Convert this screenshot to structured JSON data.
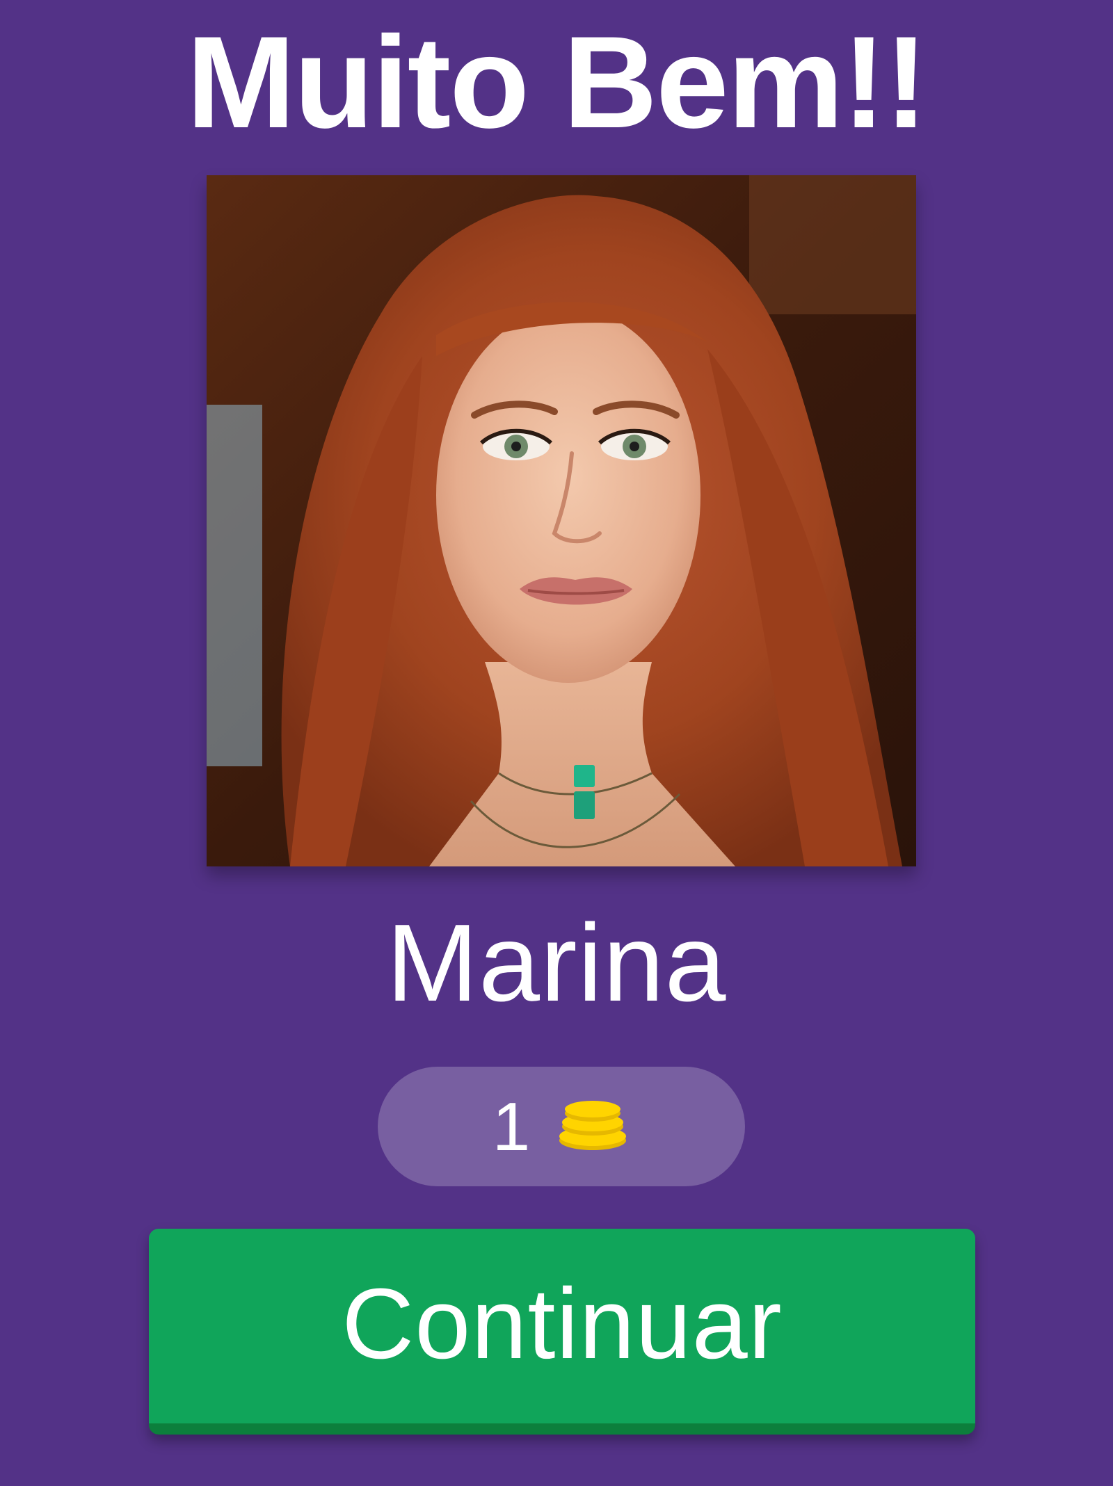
{
  "screen": {
    "title": "Muito Bem!!",
    "answer": "Marina",
    "reward": {
      "amount": "1",
      "icon": "coins-icon"
    },
    "continue_label": "Continuar"
  },
  "colors": {
    "background": "#533287",
    "button": "#10a55a",
    "button_shadow": "#0c7f3c",
    "coin": "#ffd400",
    "text": "#ffffff"
  }
}
